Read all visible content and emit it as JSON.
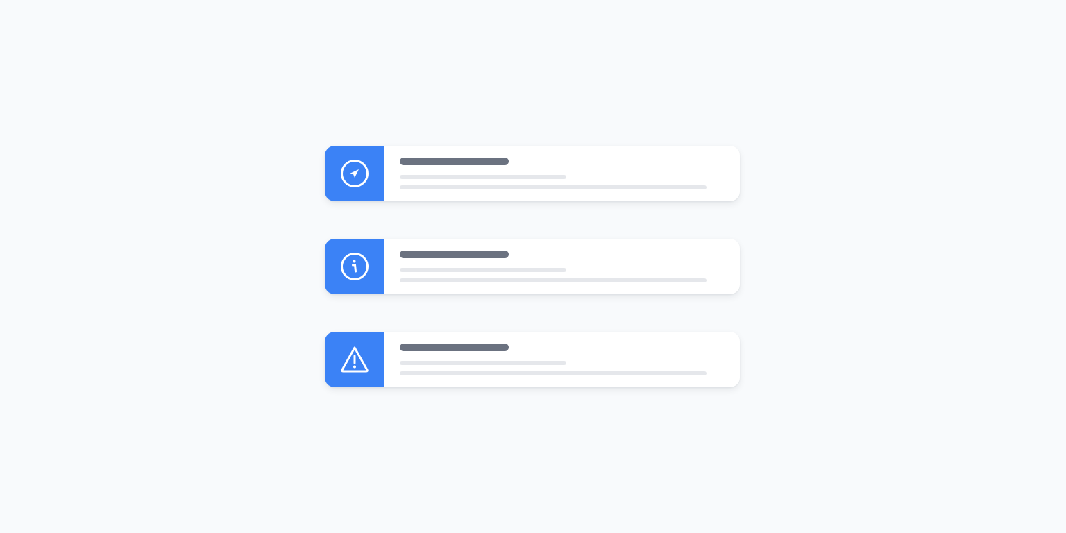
{
  "theme": {
    "accent": "#3b82f6",
    "background": "#f8fafc",
    "card": "#ffffff",
    "title_placeholder": "#6b7280",
    "line_placeholder": "#e5e7eb"
  },
  "cards": [
    {
      "icon": "compass-icon"
    },
    {
      "icon": "info-icon"
    },
    {
      "icon": "warning-icon"
    }
  ]
}
